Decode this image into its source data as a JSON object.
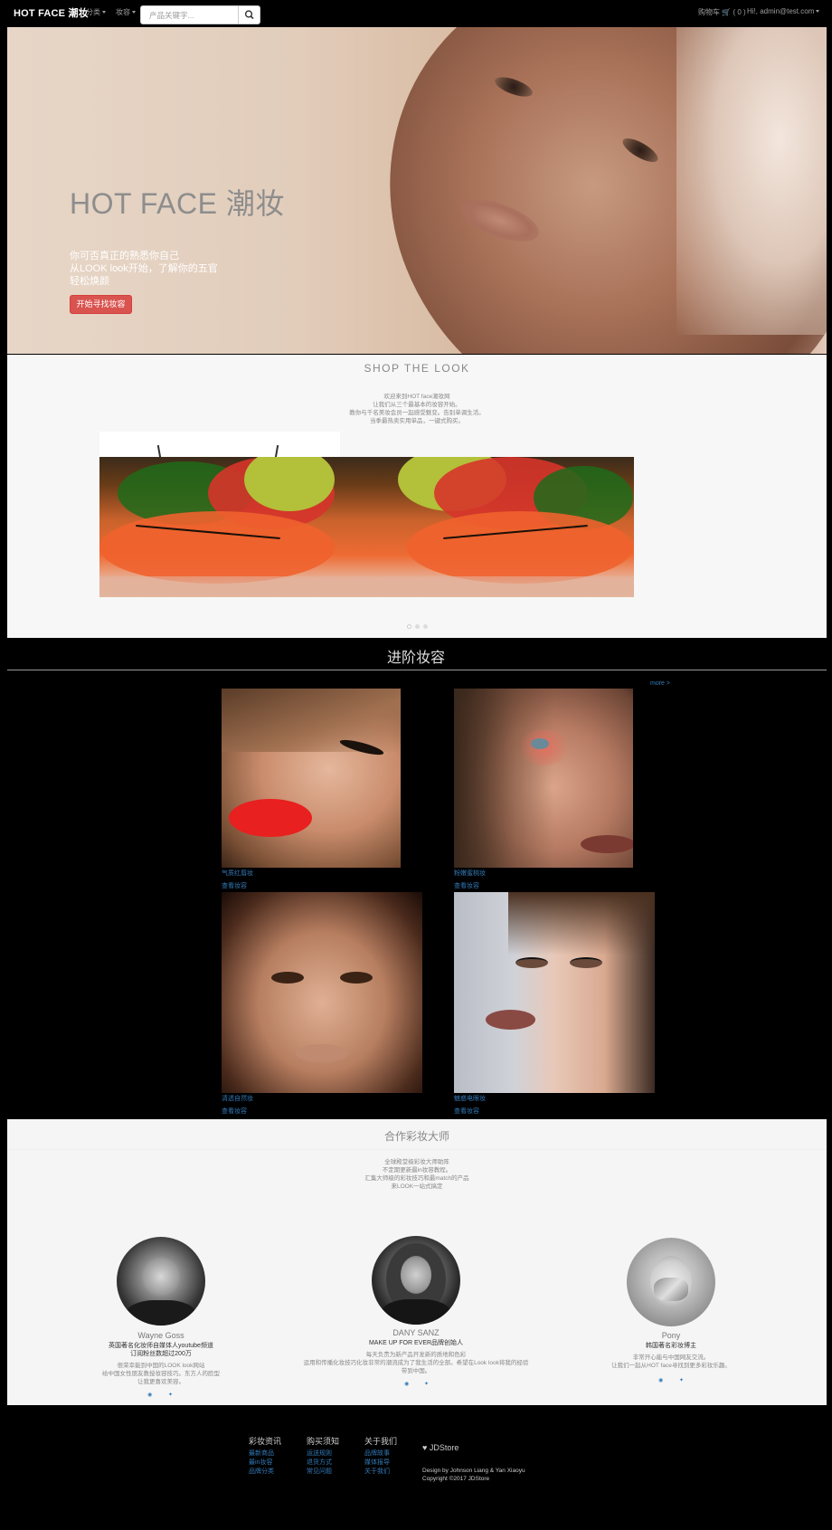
{
  "navbar": {
    "brand": "HOT FACE 潮妆",
    "menu_category": "分类",
    "menu_makeup": "妆容",
    "search_placeholder": "产品关键字...",
    "cart_label": "购物车",
    "cart_count": "( 0 )",
    "user_label": "Hi!, admin@test.com"
  },
  "hero": {
    "title": "HOT FACE 潮妆",
    "line1": "你可否真正的熟悉你自己",
    "line2": "从LOOK look开始，了解你的五官",
    "line3": "轻松焕颜",
    "button": "开始寻找妆容"
  },
  "shop": {
    "title": "SHOP THE LOOK",
    "lines": [
      "欢迎来到HOT face潮妆网",
      "让我们从三个最基本的妆容开始。",
      "教你与千名美妆会员一起感受魅变。告别单调生活。",
      "当季最热卖实用单品，一键式购买。"
    ]
  },
  "advanced": {
    "title": "进阶妆容",
    "more": "more >",
    "cards": [
      {
        "name": "气质红唇妆",
        "link": "查看妆容"
      },
      {
        "name": "粉嫩蜜桃妆",
        "link": "查看妆容"
      },
      {
        "name": "清透自然妆",
        "link": "查看妆容"
      },
      {
        "name": "魅惑电眼妆",
        "link": "查看妆容"
      }
    ]
  },
  "masters": {
    "title": "合作彩妆大师",
    "lines": [
      "全球殿堂级彩妆大师助阵",
      "不定期更新最in妆容教程。",
      "汇集大师级的彩妆技巧和最match的产品",
      "来LOOK一站式搞定"
    ],
    "people": [
      {
        "name": "Wayne Goss",
        "sub1": "英国著名化妆师自媒体人youtube频道",
        "sub2": "订阅粉丝数超过200万",
        "desc1": "很荣幸能到中国的LOOK look网站",
        "desc2": "给中国女性朋友教授妆容技巧。东方人的脸型",
        "desc3": "让我更喜欢美容。"
      },
      {
        "name": "DANY SANZ",
        "sub1": "MAKE UP FOR EVER品牌创始人",
        "desc1": "每天负责为新产品开发新的质地和色彩",
        "desc2": "运用和传播化妆技巧化妆非常的潮流成为了我生活的全部。希望在Look look将我的经验",
        "desc3": "带到中国。"
      },
      {
        "name": "Pony",
        "sub1": "韩国著名彩妆博主",
        "desc1": "非常开心能与中国网友交流。",
        "desc2": "让我们一起从HOT face寻找到更多彩妆乐趣。"
      }
    ]
  },
  "footer": {
    "col1": {
      "head": "彩妆资讯",
      "links": [
        "最新商品",
        "最in妆容",
        "品牌分类"
      ]
    },
    "col2": {
      "head": "购买须知",
      "links": [
        "运送规则",
        "退货方式",
        "常见问题"
      ]
    },
    "col3": {
      "head": "关于我们",
      "links": [
        "品牌故事",
        "媒体报导",
        "关于我们"
      ]
    },
    "brand": "JDStore",
    "credit1": "Design by Johnson Liang & Yan Xiaoyu",
    "credit2": "Copyright ©2017 JDStore"
  },
  "colors": {
    "link": "#337ab7",
    "accent_button": "#d9534f"
  }
}
